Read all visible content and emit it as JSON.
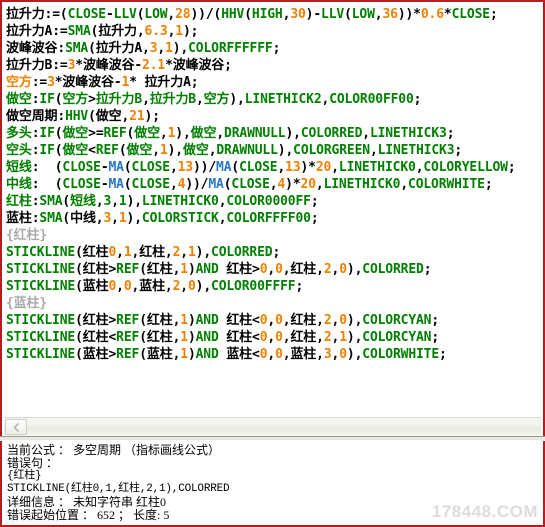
{
  "editor": {
    "lines": [
      [
        {
          "t": "拉升力:=(",
          "c": "black"
        },
        {
          "t": "CLOSE",
          "c": "green"
        },
        {
          "t": "-",
          "c": "black"
        },
        {
          "t": "LLV",
          "c": "green"
        },
        {
          "t": "(",
          "c": "black"
        },
        {
          "t": "LOW",
          "c": "green"
        },
        {
          "t": ",",
          "c": "black"
        },
        {
          "t": "28",
          "c": "orange"
        },
        {
          "t": "))/(",
          "c": "black"
        },
        {
          "t": "HHV",
          "c": "green"
        },
        {
          "t": "(",
          "c": "black"
        },
        {
          "t": "HIGH",
          "c": "green"
        },
        {
          "t": ",",
          "c": "black"
        },
        {
          "t": "30",
          "c": "orange"
        },
        {
          "t": ")-",
          "c": "black"
        },
        {
          "t": "LLV",
          "c": "green"
        },
        {
          "t": "(",
          "c": "black"
        },
        {
          "t": "LOW",
          "c": "green"
        },
        {
          "t": ",",
          "c": "black"
        },
        {
          "t": "36",
          "c": "orange"
        },
        {
          "t": "))*",
          "c": "black"
        },
        {
          "t": "0.6",
          "c": "orange"
        },
        {
          "t": "*",
          "c": "black"
        },
        {
          "t": "CLOSE",
          "c": "green"
        },
        {
          "t": ";",
          "c": "black"
        }
      ],
      [
        {
          "t": "拉升力A:=",
          "c": "black"
        },
        {
          "t": "SMA",
          "c": "green"
        },
        {
          "t": "(拉升力,",
          "c": "black"
        },
        {
          "t": "6.3",
          "c": "orange"
        },
        {
          "t": ",",
          "c": "black"
        },
        {
          "t": "1",
          "c": "orange"
        },
        {
          "t": ");",
          "c": "black"
        }
      ],
      [
        {
          "t": "波峰波谷:",
          "c": "black"
        },
        {
          "t": "SMA",
          "c": "green"
        },
        {
          "t": "(拉升力A,",
          "c": "black"
        },
        {
          "t": "3",
          "c": "orange"
        },
        {
          "t": ",",
          "c": "black"
        },
        {
          "t": "1",
          "c": "orange"
        },
        {
          "t": "),",
          "c": "black"
        },
        {
          "t": "COLORFFFFFF",
          "c": "green"
        },
        {
          "t": ";",
          "c": "black"
        }
      ],
      [
        {
          "t": "拉升力B:=",
          "c": "black"
        },
        {
          "t": "3",
          "c": "orange"
        },
        {
          "t": "*波峰波谷-",
          "c": "black"
        },
        {
          "t": "2.1",
          "c": "orange"
        },
        {
          "t": "*波峰波谷;",
          "c": "black"
        }
      ],
      [
        {
          "t": "空方",
          "c": "orange"
        },
        {
          "t": ":=",
          "c": "black"
        },
        {
          "t": "3",
          "c": "orange"
        },
        {
          "t": "*波峰波谷-",
          "c": "black"
        },
        {
          "t": "1",
          "c": "orange"
        },
        {
          "t": "* 拉升力A;",
          "c": "black"
        }
      ],
      [
        {
          "t": "做空",
          "c": "green"
        },
        {
          "t": ":",
          "c": "black"
        },
        {
          "t": "IF",
          "c": "green"
        },
        {
          "t": "(",
          "c": "black"
        },
        {
          "t": "空方",
          "c": "green"
        },
        {
          "t": ">",
          "c": "black"
        },
        {
          "t": "拉升力B",
          "c": "green"
        },
        {
          "t": ",",
          "c": "black"
        },
        {
          "t": "拉升力B",
          "c": "green"
        },
        {
          "t": ",",
          "c": "black"
        },
        {
          "t": "空方",
          "c": "green"
        },
        {
          "t": "),",
          "c": "black"
        },
        {
          "t": "LINETHICK2",
          "c": "green"
        },
        {
          "t": ",",
          "c": "black"
        },
        {
          "t": "COLOR00FF00",
          "c": "green"
        },
        {
          "t": ";",
          "c": "black"
        }
      ],
      [
        {
          "t": "做空周期:",
          "c": "black"
        },
        {
          "t": "HHV",
          "c": "green"
        },
        {
          "t": "(做空,",
          "c": "black"
        },
        {
          "t": "21",
          "c": "orange"
        },
        {
          "t": ");",
          "c": "black"
        }
      ],
      [
        {
          "t": "多头",
          "c": "green"
        },
        {
          "t": ":",
          "c": "black"
        },
        {
          "t": "IF",
          "c": "green"
        },
        {
          "t": "(",
          "c": "black"
        },
        {
          "t": "做空",
          "c": "green"
        },
        {
          "t": ">=",
          "c": "black"
        },
        {
          "t": "REF",
          "c": "green"
        },
        {
          "t": "(",
          "c": "black"
        },
        {
          "t": "做空",
          "c": "green"
        },
        {
          "t": ",",
          "c": "black"
        },
        {
          "t": "1",
          "c": "orange"
        },
        {
          "t": "),",
          "c": "black"
        },
        {
          "t": "做空",
          "c": "green"
        },
        {
          "t": ",",
          "c": "black"
        },
        {
          "t": "DRAWNULL",
          "c": "green"
        },
        {
          "t": "),",
          "c": "black"
        },
        {
          "t": "COLORRED",
          "c": "green"
        },
        {
          "t": ",",
          "c": "black"
        },
        {
          "t": "LINETHICK3",
          "c": "green"
        },
        {
          "t": ";",
          "c": "black"
        }
      ],
      [
        {
          "t": "空头",
          "c": "green"
        },
        {
          "t": ":",
          "c": "black"
        },
        {
          "t": "IF",
          "c": "green"
        },
        {
          "t": "(",
          "c": "black"
        },
        {
          "t": "做空",
          "c": "green"
        },
        {
          "t": "<",
          "c": "black"
        },
        {
          "t": "REF",
          "c": "green"
        },
        {
          "t": "(",
          "c": "black"
        },
        {
          "t": "做空",
          "c": "green"
        },
        {
          "t": ",",
          "c": "black"
        },
        {
          "t": "1",
          "c": "orange"
        },
        {
          "t": "),",
          "c": "black"
        },
        {
          "t": "做空",
          "c": "green"
        },
        {
          "t": ",",
          "c": "black"
        },
        {
          "t": "DRAWNULL",
          "c": "green"
        },
        {
          "t": "),",
          "c": "black"
        },
        {
          "t": "COLORGREEN",
          "c": "green"
        },
        {
          "t": ",",
          "c": "black"
        },
        {
          "t": "LINETHICK3",
          "c": "green"
        },
        {
          "t": ";",
          "c": "black"
        }
      ],
      [
        {
          "t": "短线",
          "c": "green"
        },
        {
          "t": ":  (",
          "c": "black"
        },
        {
          "t": "CLOSE",
          "c": "green"
        },
        {
          "t": "-",
          "c": "black"
        },
        {
          "t": "MA",
          "c": "blue"
        },
        {
          "t": "(",
          "c": "black"
        },
        {
          "t": "CLOSE",
          "c": "green"
        },
        {
          "t": ",",
          "c": "black"
        },
        {
          "t": "13",
          "c": "orange"
        },
        {
          "t": "))/",
          "c": "black"
        },
        {
          "t": "MA",
          "c": "blue"
        },
        {
          "t": "(",
          "c": "black"
        },
        {
          "t": "CLOSE",
          "c": "green"
        },
        {
          "t": ",",
          "c": "black"
        },
        {
          "t": "13",
          "c": "orange"
        },
        {
          "t": ")*",
          "c": "black"
        },
        {
          "t": "20",
          "c": "orange"
        },
        {
          "t": ",",
          "c": "black"
        },
        {
          "t": "LINETHICK0",
          "c": "green"
        },
        {
          "t": ",",
          "c": "black"
        },
        {
          "t": "COLORYELLOW",
          "c": "green"
        },
        {
          "t": ";",
          "c": "black"
        }
      ],
      [
        {
          "t": "中线",
          "c": "green"
        },
        {
          "t": ":  (",
          "c": "black"
        },
        {
          "t": "CLOSE",
          "c": "green"
        },
        {
          "t": "-",
          "c": "black"
        },
        {
          "t": "MA",
          "c": "blue"
        },
        {
          "t": "(",
          "c": "black"
        },
        {
          "t": "CLOSE",
          "c": "green"
        },
        {
          "t": ",",
          "c": "black"
        },
        {
          "t": "4",
          "c": "orange"
        },
        {
          "t": "))/",
          "c": "black"
        },
        {
          "t": "MA",
          "c": "blue"
        },
        {
          "t": "(",
          "c": "black"
        },
        {
          "t": "CLOSE",
          "c": "green"
        },
        {
          "t": ",",
          "c": "black"
        },
        {
          "t": "4",
          "c": "orange"
        },
        {
          "t": ")*",
          "c": "black"
        },
        {
          "t": "20",
          "c": "orange"
        },
        {
          "t": ",",
          "c": "black"
        },
        {
          "t": "LINETHICK0",
          "c": "green"
        },
        {
          "t": ",",
          "c": "black"
        },
        {
          "t": "COLORWHITE",
          "c": "green"
        },
        {
          "t": ";",
          "c": "black"
        }
      ],
      [
        {
          "t": "红柱",
          "c": "green"
        },
        {
          "t": ":",
          "c": "black"
        },
        {
          "t": "SMA",
          "c": "green"
        },
        {
          "t": "(",
          "c": "black"
        },
        {
          "t": "短线",
          "c": "green"
        },
        {
          "t": ",",
          "c": "black"
        },
        {
          "t": "3",
          "c": "green"
        },
        {
          "t": ",",
          "c": "black"
        },
        {
          "t": "1",
          "c": "green"
        },
        {
          "t": "),",
          "c": "black"
        },
        {
          "t": "LINETHICK0",
          "c": "green"
        },
        {
          "t": ",",
          "c": "black"
        },
        {
          "t": "COLOR0000FF",
          "c": "green"
        },
        {
          "t": ";",
          "c": "black"
        }
      ],
      [
        {
          "t": "蓝柱",
          "c": "black"
        },
        {
          "t": ":",
          "c": "black"
        },
        {
          "t": "SMA",
          "c": "green"
        },
        {
          "t": "(中线,",
          "c": "black"
        },
        {
          "t": "3",
          "c": "orange"
        },
        {
          "t": ",",
          "c": "black"
        },
        {
          "t": "1",
          "c": "orange"
        },
        {
          "t": "),",
          "c": "black"
        },
        {
          "t": "COLORSTICK",
          "c": "green"
        },
        {
          "t": ",",
          "c": "black"
        },
        {
          "t": "COLORFFFF00",
          "c": "green"
        },
        {
          "t": ";",
          "c": "black"
        }
      ],
      [
        {
          "t": "{红柱}",
          "c": "gray"
        }
      ],
      [
        {
          "t": "STICKLINE",
          "c": "green"
        },
        {
          "t": "(红柱",
          "c": "black"
        },
        {
          "t": "0",
          "c": "orange"
        },
        {
          "t": ",",
          "c": "black"
        },
        {
          "t": "1",
          "c": "orange"
        },
        {
          "t": ",红柱,",
          "c": "black"
        },
        {
          "t": "2",
          "c": "orange"
        },
        {
          "t": ",",
          "c": "black"
        },
        {
          "t": "1",
          "c": "orange"
        },
        {
          "t": "),",
          "c": "black"
        },
        {
          "t": "COLORRED",
          "c": "green"
        },
        {
          "t": ";",
          "c": "black"
        }
      ],
      [
        {
          "t": "STICKLINE",
          "c": "green"
        },
        {
          "t": "(红柱>",
          "c": "black"
        },
        {
          "t": "REF",
          "c": "green"
        },
        {
          "t": "(红柱,",
          "c": "black"
        },
        {
          "t": "1",
          "c": "orange"
        },
        {
          "t": ")",
          "c": "black"
        },
        {
          "t": "AND",
          "c": "green"
        },
        {
          "t": " 红柱>",
          "c": "black"
        },
        {
          "t": "0",
          "c": "orange"
        },
        {
          "t": ",",
          "c": "black"
        },
        {
          "t": "0",
          "c": "orange"
        },
        {
          "t": ",红柱,",
          "c": "black"
        },
        {
          "t": "2",
          "c": "orange"
        },
        {
          "t": ",",
          "c": "black"
        },
        {
          "t": "0",
          "c": "orange"
        },
        {
          "t": "),",
          "c": "black"
        },
        {
          "t": "COLORRED",
          "c": "green"
        },
        {
          "t": ";",
          "c": "black"
        }
      ],
      [
        {
          "t": "STICKLINE",
          "c": "green"
        },
        {
          "t": "(蓝柱",
          "c": "black"
        },
        {
          "t": "0",
          "c": "orange"
        },
        {
          "t": ",",
          "c": "black"
        },
        {
          "t": "0",
          "c": "orange"
        },
        {
          "t": ",蓝柱,",
          "c": "black"
        },
        {
          "t": "2",
          "c": "orange"
        },
        {
          "t": ",",
          "c": "black"
        },
        {
          "t": "0",
          "c": "orange"
        },
        {
          "t": "),",
          "c": "black"
        },
        {
          "t": "COLOR00FFFF",
          "c": "green"
        },
        {
          "t": ";",
          "c": "black"
        }
      ],
      [
        {
          "t": "{蓝柱}",
          "c": "gray"
        }
      ],
      [
        {
          "t": "STICKLINE",
          "c": "green"
        },
        {
          "t": "(红柱>",
          "c": "black"
        },
        {
          "t": "REF",
          "c": "green"
        },
        {
          "t": "(红柱,",
          "c": "black"
        },
        {
          "t": "1",
          "c": "orange"
        },
        {
          "t": ")",
          "c": "black"
        },
        {
          "t": "AND",
          "c": "green"
        },
        {
          "t": " 红柱<",
          "c": "black"
        },
        {
          "t": "0",
          "c": "orange"
        },
        {
          "t": ",",
          "c": "black"
        },
        {
          "t": "0",
          "c": "orange"
        },
        {
          "t": ",红柱,",
          "c": "black"
        },
        {
          "t": "2",
          "c": "orange"
        },
        {
          "t": ",",
          "c": "black"
        },
        {
          "t": "0",
          "c": "orange"
        },
        {
          "t": "),",
          "c": "black"
        },
        {
          "t": "COLORCYAN",
          "c": "green"
        },
        {
          "t": ";",
          "c": "black"
        }
      ],
      [
        {
          "t": "STICKLINE",
          "c": "green"
        },
        {
          "t": "(红柱<",
          "c": "black"
        },
        {
          "t": "REF",
          "c": "green"
        },
        {
          "t": "(红柱,",
          "c": "black"
        },
        {
          "t": "1",
          "c": "orange"
        },
        {
          "t": ")",
          "c": "black"
        },
        {
          "t": "AND",
          "c": "green"
        },
        {
          "t": " 红柱<",
          "c": "black"
        },
        {
          "t": "0",
          "c": "orange"
        },
        {
          "t": ",",
          "c": "black"
        },
        {
          "t": "0",
          "c": "orange"
        },
        {
          "t": ",红柱,",
          "c": "black"
        },
        {
          "t": "2",
          "c": "orange"
        },
        {
          "t": ",",
          "c": "black"
        },
        {
          "t": "1",
          "c": "orange"
        },
        {
          "t": "),",
          "c": "black"
        },
        {
          "t": "COLORCYAN",
          "c": "green"
        },
        {
          "t": ";",
          "c": "black"
        }
      ],
      [
        {
          "t": "STICKLINE",
          "c": "green"
        },
        {
          "t": "(蓝柱>",
          "c": "black"
        },
        {
          "t": "REF",
          "c": "green"
        },
        {
          "t": "(蓝柱,",
          "c": "black"
        },
        {
          "t": "1",
          "c": "orange"
        },
        {
          "t": ")",
          "c": "black"
        },
        {
          "t": "AND",
          "c": "green"
        },
        {
          "t": " 蓝柱<",
          "c": "black"
        },
        {
          "t": "0",
          "c": "orange"
        },
        {
          "t": ",",
          "c": "black"
        },
        {
          "t": "0",
          "c": "orange"
        },
        {
          "t": ",蓝柱,",
          "c": "black"
        },
        {
          "t": "3",
          "c": "orange"
        },
        {
          "t": ",",
          "c": "black"
        },
        {
          "t": "0",
          "c": "orange"
        },
        {
          "t": "),",
          "c": "black"
        },
        {
          "t": "COLORWHITE",
          "c": "green"
        },
        {
          "t": ";",
          "c": "black"
        }
      ]
    ]
  },
  "scrollbar": {
    "left_arrow_icon": "chevron-left-icon"
  },
  "messages": {
    "lines": [
      {
        "text": "当前公式 ： 多空周期 （指标画线公式）",
        "mono": false
      },
      {
        "text": "错误句 ：",
        "mono": false
      },
      {
        "text": "{红柱}",
        "mono": true
      },
      {
        "text": "STICKLINE(红柱0,1,红柱,2,1),COLORRED",
        "mono": true
      },
      {
        "text": "详细信息 ： 未知字符串 红柱0",
        "mono": false
      },
      {
        "text": "错误起始位置 ： 652 ； 长度: 5",
        "mono": false
      }
    ]
  },
  "watermark": {
    "text": "178448.COM"
  },
  "colors": {
    "border": "#b61d1d",
    "keyword": "#008000",
    "number": "#f08000",
    "identifier": "#000000",
    "ma_function": "#2878c8",
    "comment": "#aaaaaa",
    "watermark": "#dcdcdc"
  }
}
